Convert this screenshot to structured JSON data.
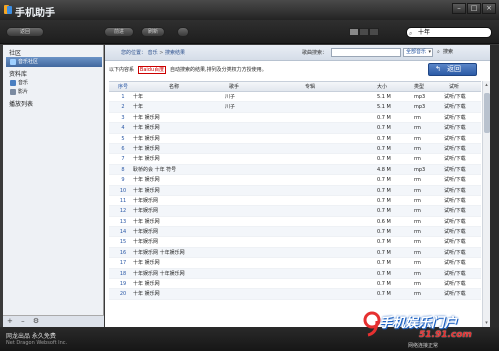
{
  "app": {
    "title": "手机助手",
    "search_value": "十年"
  },
  "toolbar": {
    "back_label": "返回",
    "forward_label": "前进",
    "refresh_label": "刷新"
  },
  "window_controls": {
    "minimize": "–",
    "maximize": "□",
    "close": "×"
  },
  "sidebar": {
    "section1": "社区",
    "item_music_community": "音乐社区",
    "section2": "资料库",
    "item_music": "音乐",
    "item_video": "影片",
    "section3": "播放列表",
    "bottom_add": "+",
    "bottom_remove": "–",
    "bottom_settings": "⚙"
  },
  "breadcrumb": {
    "prefix": "您的位置：",
    "level1": "音乐",
    "sep": " > ",
    "level2": "搜索结果"
  },
  "song_search": {
    "label": "歌曲搜索：",
    "value": "",
    "scope": "全部音乐",
    "button": "搜索"
  },
  "info": {
    "prefix": "以下内容系",
    "logo_text": "Baidu百度",
    "suffix": "自动搜索的结果,排列及分类权力方授使用。"
  },
  "back_button": "返回",
  "table": {
    "headers": {
      "num": "序号",
      "name": "名称",
      "singer": "歌手",
      "album": "专辑",
      "size": "大小",
      "type": "类型",
      "action": "试听"
    },
    "rows": [
      {
        "num": "1",
        "name": "十年",
        "singer": "川子",
        "album": "",
        "size": "5.1 M",
        "type": "mp3",
        "action": "试听/下载"
      },
      {
        "num": "2",
        "name": "十年",
        "singer": "川子",
        "album": "",
        "size": "5.1 M",
        "type": "mp3",
        "action": "试听/下载"
      },
      {
        "num": "3",
        "name": "十年 娱乐网",
        "singer": "",
        "album": "",
        "size": "0.7 M",
        "type": "rm",
        "action": "试听/下载"
      },
      {
        "num": "4",
        "name": "十年 娱乐网",
        "singer": "",
        "album": "",
        "size": "0.7 M",
        "type": "rm",
        "action": "试听/下载"
      },
      {
        "num": "5",
        "name": "十年 娱乐网",
        "singer": "",
        "album": "",
        "size": "0.7 M",
        "type": "rm",
        "action": "试听/下载"
      },
      {
        "num": "6",
        "name": "十年 娱乐网",
        "singer": "",
        "album": "",
        "size": "0.7 M",
        "type": "rm",
        "action": "试听/下载"
      },
      {
        "num": "7",
        "name": "十年 娱乐网",
        "singer": "",
        "album": "",
        "size": "0.7 M",
        "type": "rm",
        "action": "试听/下载"
      },
      {
        "num": "8",
        "name": "耿桥的会 十年 符号",
        "singer": "",
        "album": "",
        "size": "4.8 M",
        "type": "mp3",
        "action": "试听/下载"
      },
      {
        "num": "9",
        "name": "十年 娱乐网",
        "singer": "",
        "album": "",
        "size": "0.7 M",
        "type": "rm",
        "action": "试听/下载"
      },
      {
        "num": "10",
        "name": "十年 娱乐网",
        "singer": "",
        "album": "",
        "size": "0.7 M",
        "type": "rm",
        "action": "试听/下载"
      },
      {
        "num": "11",
        "name": "十年娱乐网",
        "singer": "",
        "album": "",
        "size": "0.7 M",
        "type": "rm",
        "action": "试听/下载"
      },
      {
        "num": "12",
        "name": "十年娱乐网",
        "singer": "",
        "album": "",
        "size": "0.7 M",
        "type": "rm",
        "action": "试听/下载"
      },
      {
        "num": "13",
        "name": "十年 娱乐网",
        "singer": "",
        "album": "",
        "size": "0.6 M",
        "type": "rm",
        "action": "试听/下载"
      },
      {
        "num": "14",
        "name": "十年娱乐网",
        "singer": "",
        "album": "",
        "size": "0.7 M",
        "type": "rm",
        "action": "试听/下载"
      },
      {
        "num": "15",
        "name": "十年娱乐网",
        "singer": "",
        "album": "",
        "size": "0.7 M",
        "type": "rm",
        "action": "试听/下载"
      },
      {
        "num": "16",
        "name": "十年娱乐网 十年娱乐网",
        "singer": "",
        "album": "",
        "size": "0.7 M",
        "type": "rm",
        "action": "试听/下载"
      },
      {
        "num": "17",
        "name": "十年 娱乐网",
        "singer": "",
        "album": "",
        "size": "0.7 M",
        "type": "rm",
        "action": "试听/下载"
      },
      {
        "num": "18",
        "name": "十年娱乐网 十年娱乐网",
        "singer": "",
        "album": "",
        "size": "0.7 M",
        "type": "rm",
        "action": "试听/下载"
      },
      {
        "num": "19",
        "name": "十年 娱乐网",
        "singer": "",
        "album": "",
        "size": "0.7 M",
        "type": "rm",
        "action": "试听/下载"
      },
      {
        "num": "20",
        "name": "十年 娱乐网",
        "singer": "",
        "album": "",
        "size": "0.7 M",
        "type": "rm",
        "action": "试听/下载"
      }
    ]
  },
  "status": {
    "line1": "网龙出品 永久免费",
    "line2": "Net Dragon Websoft Inc.",
    "right": "网络连接正常"
  },
  "watermark": {
    "text": "手机娱乐门户",
    "url": "51.91.com"
  },
  "colors": {
    "accent": "#2c5ba6",
    "link": "#2a58a6",
    "watermark_red": "#e63030"
  }
}
